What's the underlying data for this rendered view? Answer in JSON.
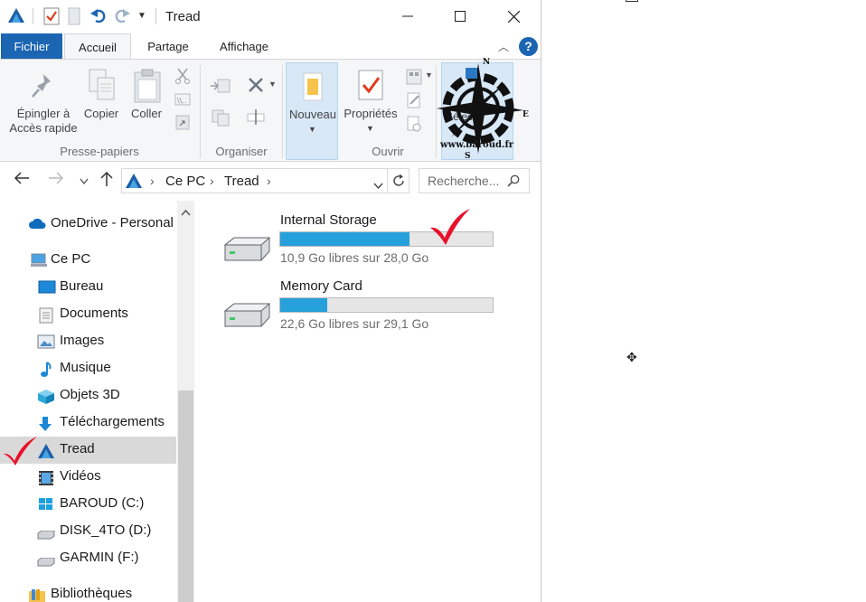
{
  "window": {
    "title": "Tread",
    "quick_access_icons": [
      "app-icon",
      "properties-check-icon",
      "new-folder-icon",
      "undo-icon",
      "redo-icon",
      "customize-dropdown-icon"
    ],
    "controls": [
      "minimize-icon",
      "maximize-icon",
      "close-icon"
    ]
  },
  "ribbon": {
    "tabs": [
      {
        "label": "Fichier"
      },
      {
        "label": "Accueil"
      },
      {
        "label": "Partage"
      },
      {
        "label": "Affichage"
      }
    ],
    "help": "?",
    "groups": {
      "clipboard": {
        "label": "Presse-papiers",
        "pin_line1": "Épingler à",
        "pin_line2": "Accès rapide",
        "copy": "Copier",
        "paste": "Coller"
      },
      "organize": {
        "label": "Organiser"
      },
      "new": {
        "new_label": "Nouveau"
      },
      "open": {
        "label": "Ouvrir",
        "properties": "Propriétés"
      }
    },
    "watermark": {
      "text": "www.baroud.fr",
      "partial_text": "Sélecti",
      "compass_letters": [
        "N",
        "E",
        "S"
      ]
    }
  },
  "navigation": {
    "breadcrumb": [
      "Ce PC",
      "Tread"
    ],
    "search_placeholder": "Recherche..."
  },
  "nav_pane": {
    "items": [
      {
        "label": "OneDrive - Personal",
        "icon": "onedrive-cloud-icon"
      },
      {
        "label": "Ce PC",
        "icon": "computer-icon"
      },
      {
        "label": "Bureau",
        "icon": "desktop-icon"
      },
      {
        "label": "Documents",
        "icon": "documents-icon"
      },
      {
        "label": "Images",
        "icon": "pictures-icon"
      },
      {
        "label": "Musique",
        "icon": "music-note-icon"
      },
      {
        "label": "Objets 3D",
        "icon": "cube-3d-icon"
      },
      {
        "label": "Téléchargements",
        "icon": "download-arrow-icon"
      },
      {
        "label": "Tread",
        "icon": "tread-device-icon",
        "selected": true
      },
      {
        "label": "Vidéos",
        "icon": "video-film-icon"
      },
      {
        "label": "BAROUD (C:)",
        "icon": "windows-drive-icon"
      },
      {
        "label": "DISK_4TO (D:)",
        "icon": "hard-drive-icon"
      },
      {
        "label": "GARMIN (F:)",
        "icon": "hard-drive-icon"
      },
      {
        "label": "Bibliothèques",
        "icon": "library-folder-icon"
      }
    ]
  },
  "drives": [
    {
      "name": "Internal Storage",
      "free": "10,9 Go libres sur 28,0 Go",
      "used_fraction": 0.61,
      "bar_color": "#26a0da"
    },
    {
      "name": "Memory Card",
      "free": "22,6 Go libres sur 29,1 Go",
      "used_fraction": 0.22,
      "bar_color": "#26a0da"
    }
  ],
  "colors": {
    "accent": "#1b65b3",
    "selection": "#d9d9d9",
    "checkmark": "#e8102a"
  }
}
